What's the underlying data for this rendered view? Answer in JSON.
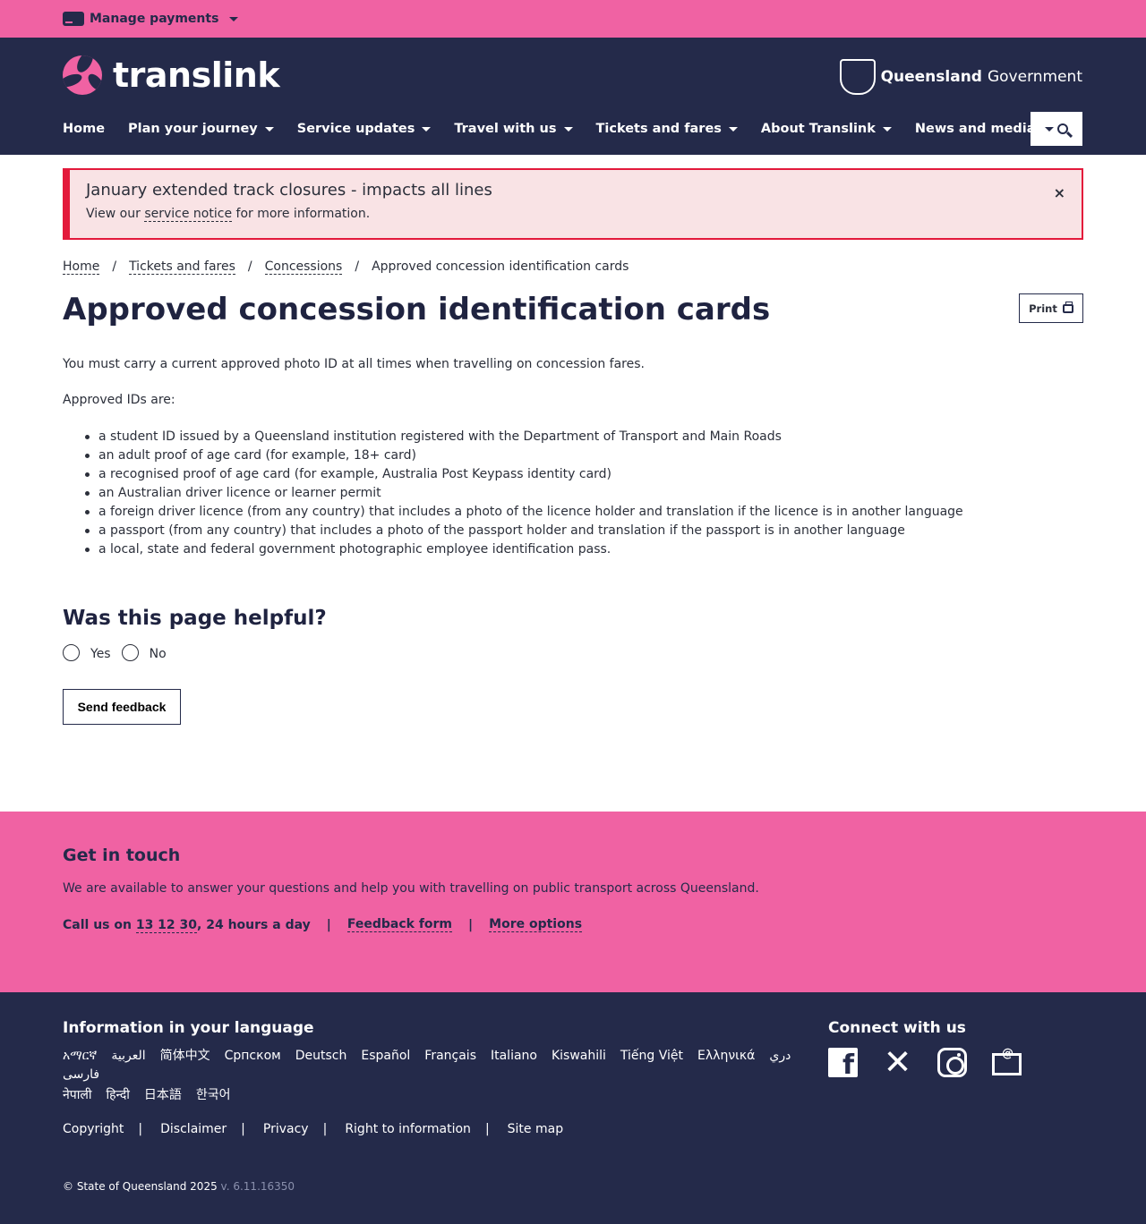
{
  "utility": {
    "manage_label": "Manage payments"
  },
  "header": {
    "logo_text": "translink",
    "gov_bold": "Queensland",
    "gov_rest": "Government"
  },
  "nav": [
    {
      "label": "Home"
    },
    {
      "label": "Plan your journey"
    },
    {
      "label": "Service updates"
    },
    {
      "label": "Travel with us"
    },
    {
      "label": "Tickets and fares"
    },
    {
      "label": "About Translink"
    },
    {
      "label": "News and media"
    }
  ],
  "alert": {
    "title": "January extended track closures - impacts all lines",
    "text_before": "View our ",
    "link": "service notice",
    "text_after": " for more information.",
    "close": "×"
  },
  "breadcrumb": {
    "home": "Home",
    "tickets": "Tickets and fares",
    "concessions": "Concessions",
    "current": "Approved concession identification cards",
    "sep": "/"
  },
  "page": {
    "title": "Approved concession identification cards",
    "print_label": "Print",
    "intro": "You must carry a current approved photo ID at all times when travelling on concession fares.",
    "approved_heading": "Approved IDs are:",
    "items": [
      "a student ID issued by a Queensland institution registered with the Department of Transport and Main Roads",
      "an adult proof of age card (for example, 18+ card)",
      "a recognised proof of age card (for example, Australia Post Keypass identity card)",
      "an Australian driver licence or learner permit",
      "a foreign driver licence (from any country) that includes a photo of the licence holder and translation if the licence is in another language",
      "a passport (from any country) that includes a photo of the passport holder and translation if the passport is in another language",
      "a local, state and federal government photographic employee identification pass."
    ]
  },
  "feedback": {
    "heading": "Was this page helpful?",
    "yes": "Yes",
    "no": "No",
    "send": "Send feedback"
  },
  "touch": {
    "heading": "Get in touch",
    "text": "We are available to answer your questions and help you with travelling on public transport across Queensland.",
    "call_prefix": "Call us on ",
    "phone": "13 12 30",
    "call_suffix": ", 24 hours a day",
    "feedback_form": "Feedback form",
    "more_options": "More options",
    "sep": "|"
  },
  "footer": {
    "lang_title": "Information in your language",
    "languages": [
      "አማርኛ",
      "العربية",
      "简体中文",
      "Српском",
      "Deutsch",
      "Español",
      "Français",
      "Italiano",
      "Kiswahili",
      "Tiếng Việt",
      "Ελληνικά",
      "دري",
      "فارسی",
      "नेपाली",
      "हिन्दी",
      "日本語",
      "한국어"
    ],
    "connect_title": "Connect with us",
    "legal": [
      "Copyright",
      "Disclaimer",
      "Privacy",
      "Right to information",
      "Site map"
    ],
    "copyright": "© State of Queensland 2025",
    "version": "v. 6.11.16350"
  }
}
